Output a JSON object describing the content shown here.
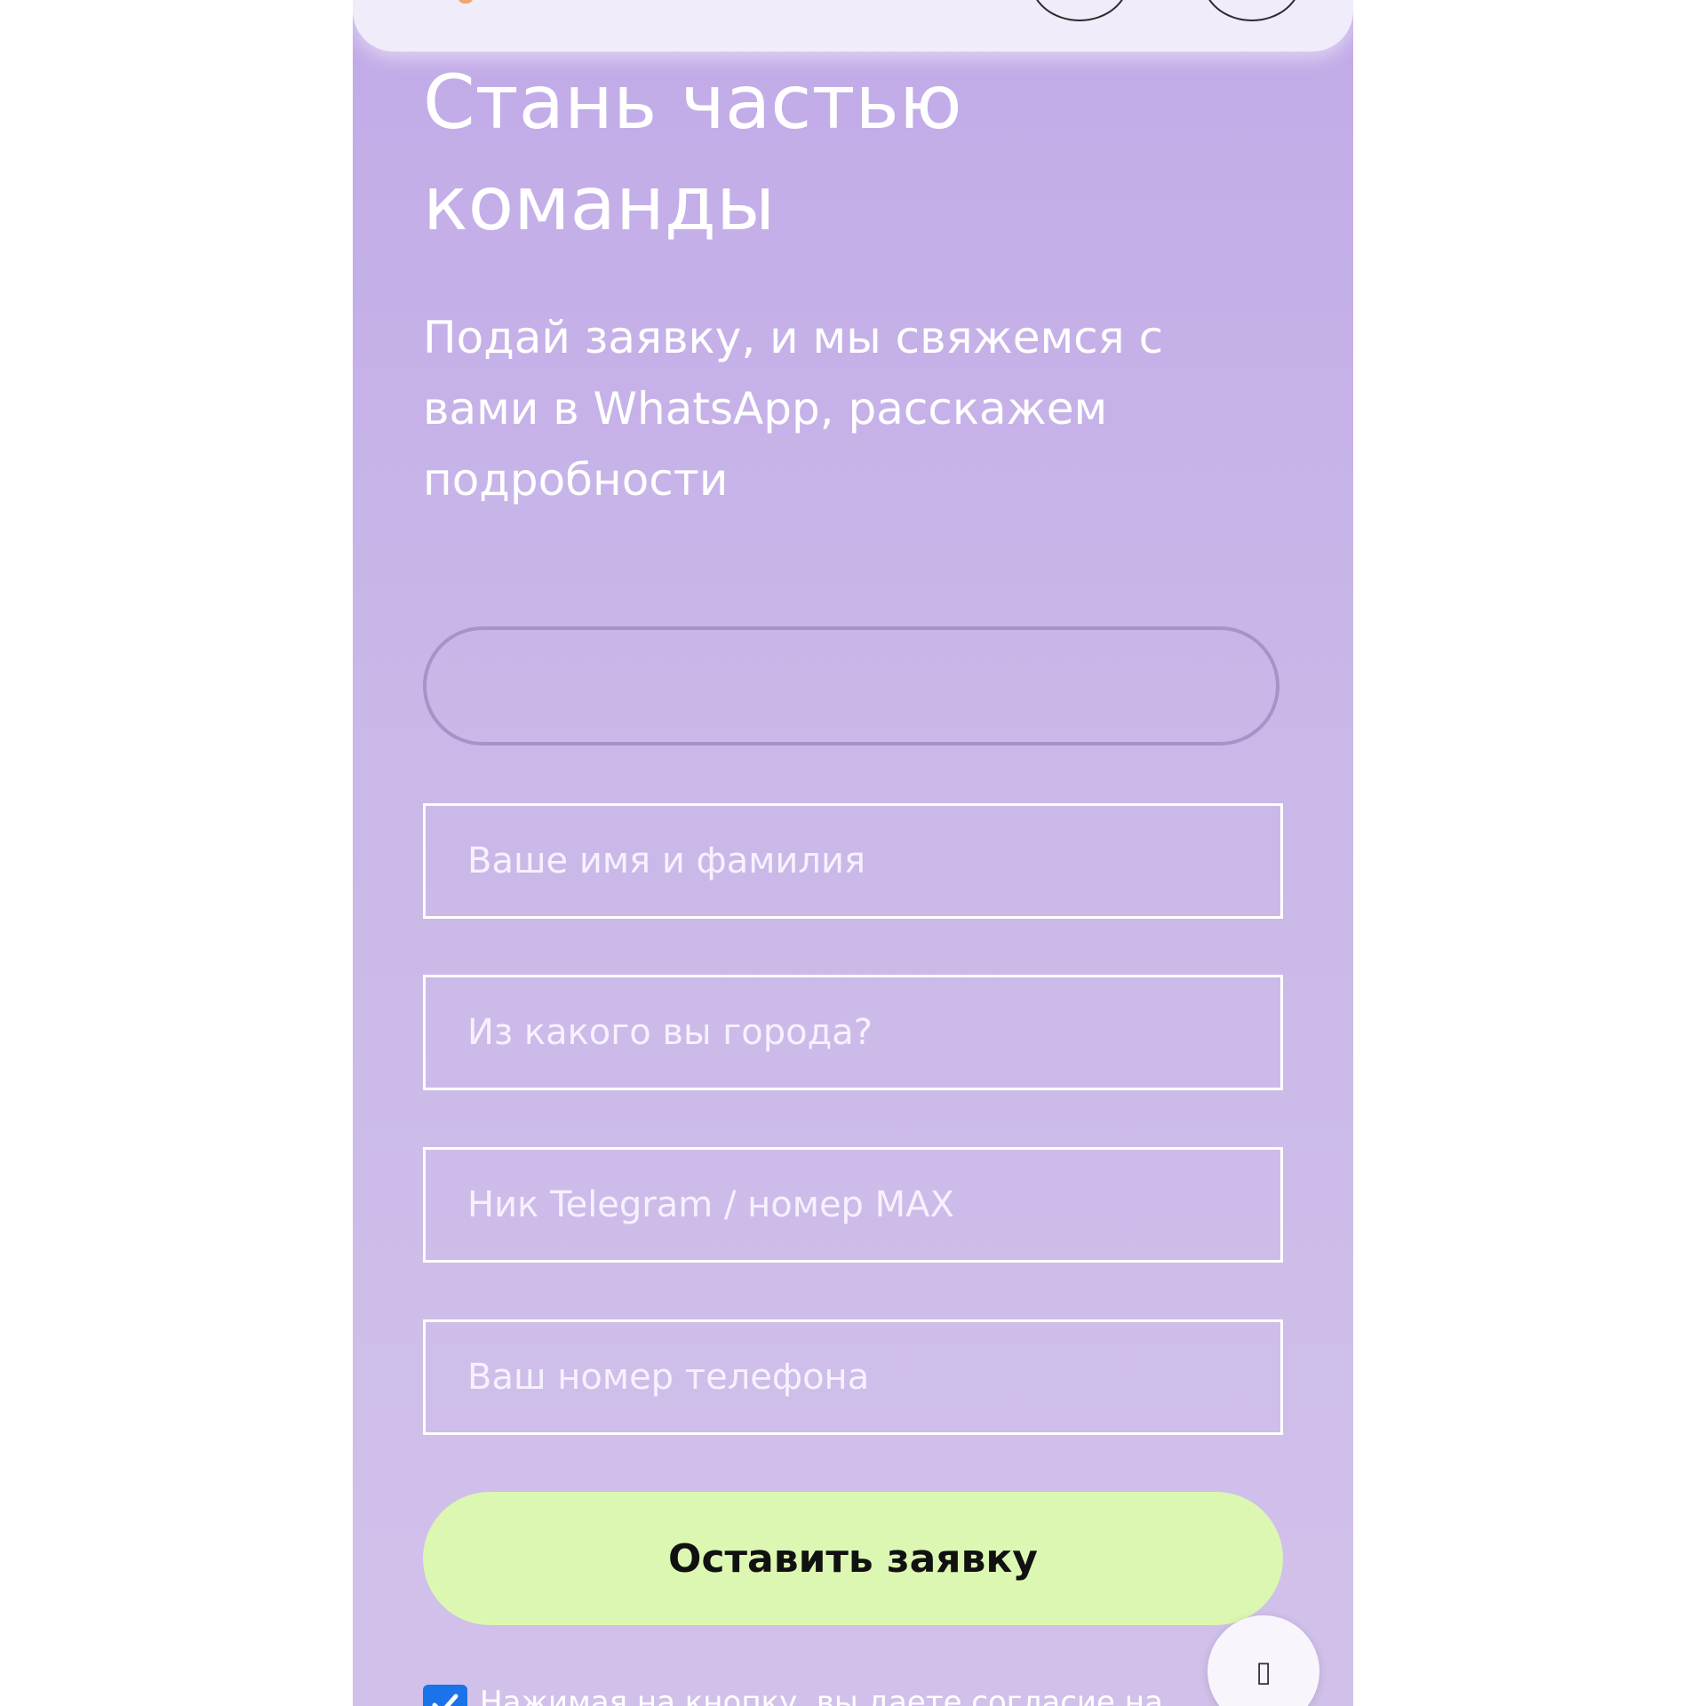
{
  "form": {
    "title": "Стань частью команды",
    "subtitle": "Подай заявку, и мы свяжемся с вами в WhatsApp, расскажем подробности",
    "name_placeholder": "Ваше имя и фамилия",
    "city_placeholder": "Из какого вы города?",
    "telegram_placeholder": "Ник Telegram / номер MAX",
    "phone_placeholder": "Ваш номер телефона",
    "submit_label": "Оставить заявку",
    "consent_text": "Нажимая на кнопку, вы даете согласие на",
    "consent_checked": true
  },
  "fab": {
    "icon": "chat-icon",
    "glyph": "▯"
  },
  "colors": {
    "background": "#c9b7e8",
    "submit_button": "#dcf7b1",
    "checkbox": "#1a73e8",
    "header": "#f0ecfa"
  }
}
